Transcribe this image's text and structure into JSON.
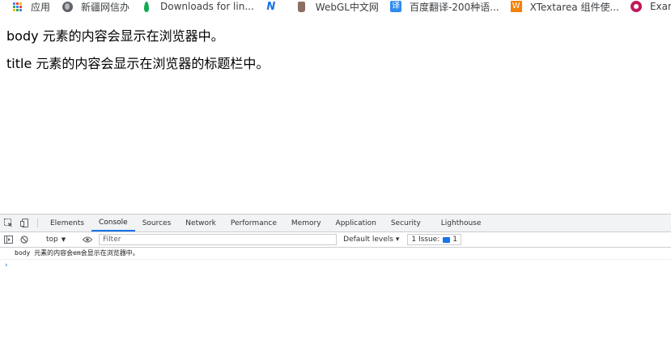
{
  "bookmarks": [
    {
      "label": "应用",
      "icon": "apps-grid-icon"
    },
    {
      "label": "新疆网信办",
      "icon": "globe-icon"
    },
    {
      "label": "Downloads for lin...",
      "icon": "mongodb-leaf-icon"
    },
    {
      "label": "",
      "icon": "n-logo-icon"
    },
    {
      "label": "WebGL中文网",
      "icon": "bottle-icon"
    },
    {
      "label": "百度翻译-200种语...",
      "icon": "translate-icon"
    },
    {
      "label": "XTextarea 组件使...",
      "icon": "w-logo-icon"
    },
    {
      "label": "Exam",
      "icon": "circle-logo-icon"
    }
  ],
  "page": {
    "line1": "body 元素的内容会显示在浏览器中。",
    "line2": "title 元素的内容会显示在浏览器的标题栏中。"
  },
  "devtools": {
    "tabs": [
      "Elements",
      "Console",
      "Sources",
      "Network",
      "Performance",
      "Memory",
      "Application",
      "Security",
      "Lighthouse"
    ],
    "active_tab": "Console",
    "context": "top",
    "filter_placeholder": "Filter",
    "levels": "Default levels ▾",
    "issues_label": "1 Issue:",
    "issues_count": "1",
    "console_message": "body 元素的内容会em会显示在浏览器中。",
    "prompt": "›"
  },
  "colors": {
    "accent": "#1a73e8",
    "devtools_bg": "#f1f3f4"
  }
}
